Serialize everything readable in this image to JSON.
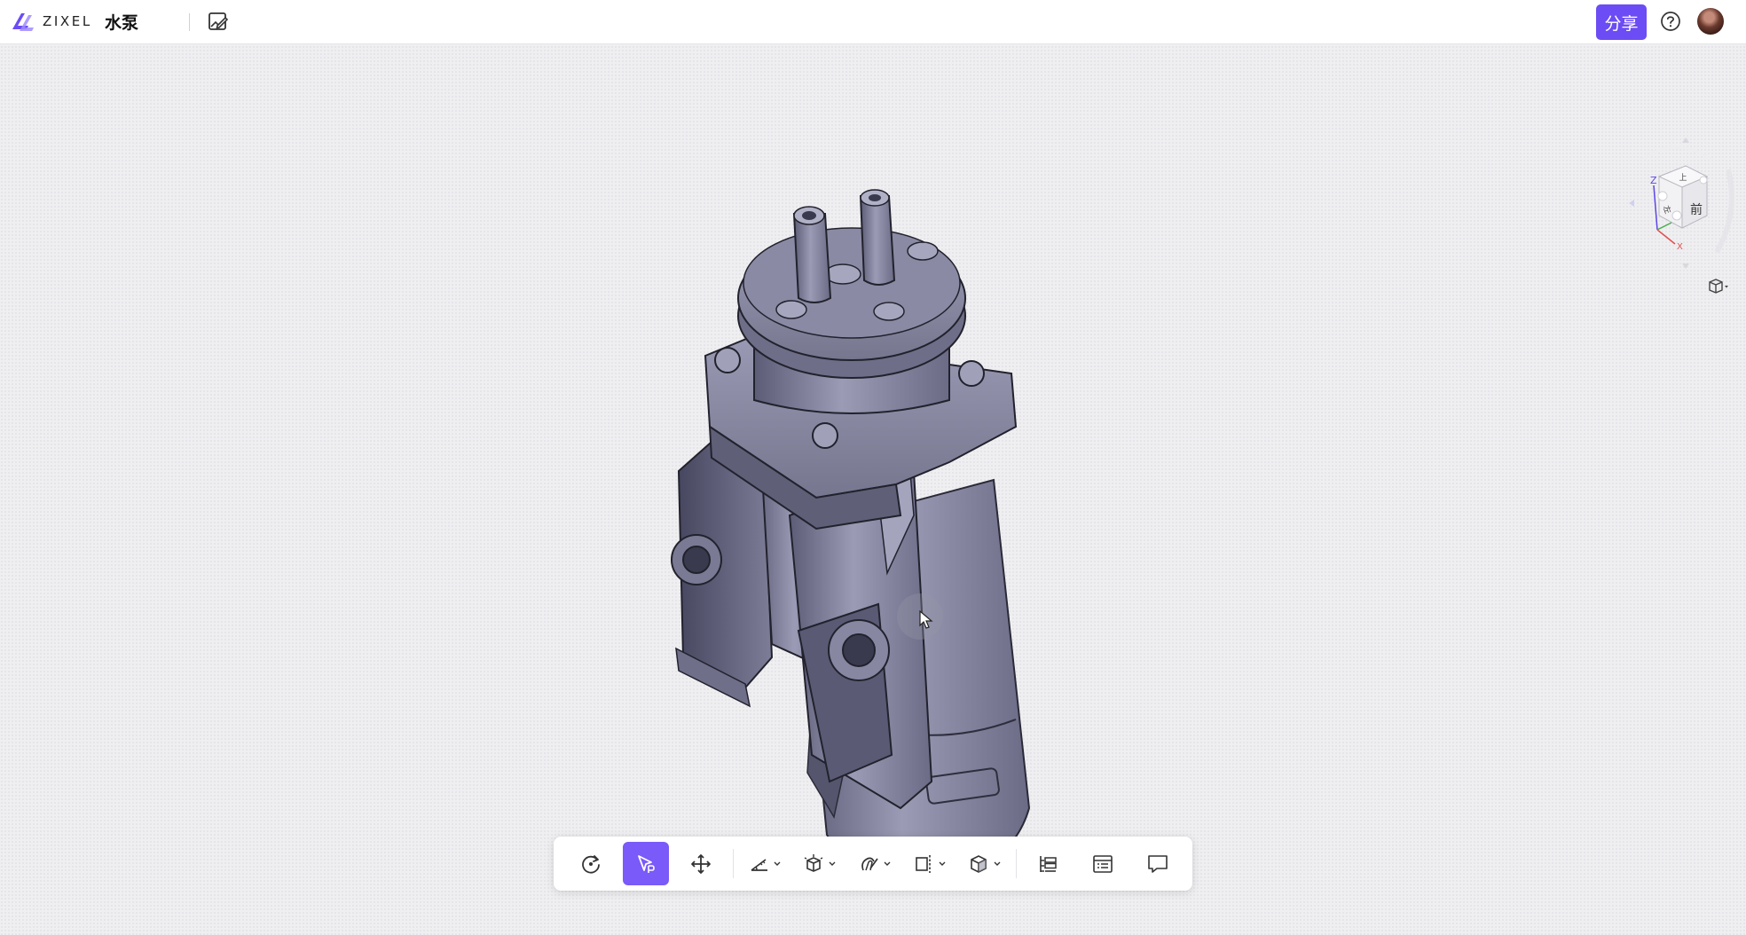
{
  "app": {
    "brand": "ZIXEL",
    "document_title": "水泵"
  },
  "header": {
    "share_label": "分享",
    "edit_icon": "edit-image-icon",
    "help_icon": "help-circle-icon"
  },
  "viewcube": {
    "face_front": "前",
    "face_top": "上",
    "face_left": "左",
    "axis_z": "Z",
    "axis_x": "X"
  },
  "colors": {
    "accent": "#6c4cf4",
    "toolbar_active": "#7a5af8",
    "model": "#8c8ca6",
    "axis_z": "#5a46e6",
    "axis_x": "#e05050",
    "axis_y": "#4caf50"
  },
  "toolbar": {
    "tools": [
      {
        "name": "rotate",
        "icon": "rotate-icon",
        "active": false
      },
      {
        "name": "select",
        "icon": "select-cursor-icon",
        "active": true
      },
      {
        "name": "pan",
        "icon": "move-arrows-icon",
        "active": false
      },
      {
        "name": "measure",
        "icon": "measure-icon",
        "active": false,
        "dropdown": true
      },
      {
        "name": "explode",
        "icon": "explode-cube-icon",
        "active": false,
        "dropdown": true
      },
      {
        "name": "annotate",
        "icon": "markup-icon",
        "active": false,
        "dropdown": true
      },
      {
        "name": "section",
        "icon": "section-plane-icon",
        "active": false,
        "dropdown": true
      },
      {
        "name": "display",
        "icon": "display-cube-icon",
        "active": false,
        "dropdown": true
      },
      {
        "name": "structure-tree",
        "icon": "tree-list-icon",
        "active": false
      },
      {
        "name": "properties",
        "icon": "properties-list-icon",
        "active": false
      },
      {
        "name": "comments",
        "icon": "comment-icon",
        "active": false
      }
    ]
  }
}
